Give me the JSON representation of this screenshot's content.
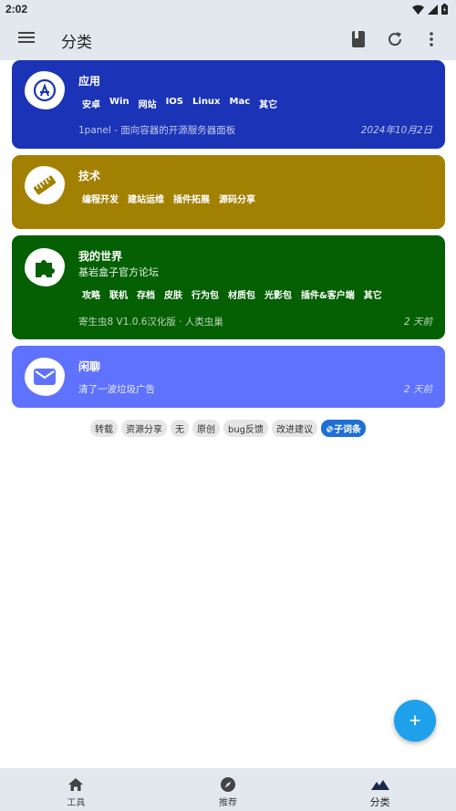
{
  "status": {
    "time": "2:02"
  },
  "app_bar": {
    "title": "分类"
  },
  "cards": [
    {
      "title": "应用",
      "tags": [
        "安卓",
        "Win",
        "网站",
        "IOS",
        "Linux",
        "Mac",
        "其它"
      ],
      "footer_left": "1panel - 面向容器的开源服务器面板",
      "footer_right": "2024年10月2日",
      "color": "#1b33b6",
      "icon": "app-store-icon"
    },
    {
      "title": "技术",
      "tags": [
        "编程开发",
        "建站运维",
        "插件拓展",
        "源码分享"
      ],
      "color": "#a28102",
      "icon": "ruler-icon"
    },
    {
      "title": "我的世界",
      "subtitle": "基岩盒子官方论坛",
      "tags": [
        "攻略",
        "联机",
        "存档",
        "皮肤",
        "行为包",
        "材质包",
        "光影包",
        "插件&客户端",
        "其它"
      ],
      "footer_left": "寄生虫8 V1.0.6汉化版 · 人类虫巢",
      "footer_right": "2 天前",
      "color": "#046002",
      "icon": "puzzle-icon"
    },
    {
      "title": "闲聊",
      "subtitle": "清了一波垃圾广告",
      "footer_right": "2 天前",
      "color": "#5f72fd",
      "icon": "mail-icon"
    }
  ],
  "chips": [
    "转载",
    "资源分享",
    "无",
    "原创",
    "bug反馈",
    "改进建议"
  ],
  "chip_active": "子词条",
  "fab": {
    "label": "+"
  },
  "bottom_nav": [
    {
      "label": "工具",
      "icon": "home-icon"
    },
    {
      "label": "推荐",
      "icon": "compass-icon"
    },
    {
      "label": "分类",
      "icon": "mountain-icon",
      "active": true
    }
  ]
}
